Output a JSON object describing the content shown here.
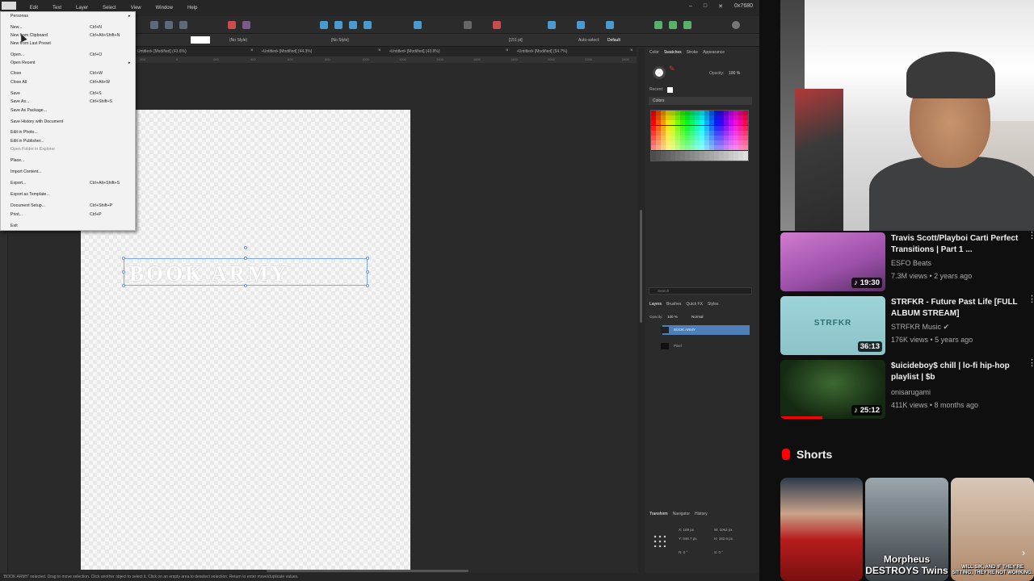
{
  "menubar": {
    "items": [
      "File",
      "Edit",
      "Text",
      "Layer",
      "Select",
      "View",
      "Window",
      "Help"
    ],
    "clock": "0x7680",
    "window_controls": [
      "–",
      "□",
      "✕"
    ]
  },
  "context_bar": {
    "style_left": "(No Style)",
    "style_right": "[No Style]",
    "font_size": "[151 pt]",
    "auto_select_label": "Auto-select:",
    "auto_select_value": "Default"
  },
  "doc_tabs": [
    {
      "label": "Untitled• [Modified] (43.6%)"
    },
    {
      "label": "•Untitled• [Modified] (44.3%)"
    },
    {
      "label": "•Untitled• [Modified] (43.8%)"
    },
    {
      "label": "•Untitled• [Modified] (54.7%)"
    }
  ],
  "file_menu": {
    "items": [
      {
        "label": "Personas",
        "shortcut": "",
        "submenu": true,
        "disabled": false
      },
      {
        "label": "New...",
        "shortcut": "Ctrl+N",
        "submenu": false,
        "disabled": false
      },
      {
        "label": "New from Clipboard",
        "shortcut": "Ctrl+Alt+Shift+N",
        "submenu": false,
        "disabled": false
      },
      {
        "label": "New from Last Preset",
        "shortcut": "",
        "submenu": false,
        "disabled": false
      },
      {
        "label": "Open...",
        "shortcut": "Ctrl+O",
        "submenu": false,
        "disabled": false
      },
      {
        "label": "Open Recent",
        "shortcut": "",
        "submenu": true,
        "disabled": false
      },
      {
        "label": "Close",
        "shortcut": "Ctrl+W",
        "submenu": false,
        "disabled": false
      },
      {
        "label": "Close All",
        "shortcut": "Ctrl+Alt+W",
        "submenu": false,
        "disabled": false
      },
      {
        "label": "Save",
        "shortcut": "Ctrl+S",
        "submenu": false,
        "disabled": false
      },
      {
        "label": "Save As...",
        "shortcut": "Ctrl+Shift+S",
        "submenu": false,
        "disabled": false
      },
      {
        "label": "Save As Package...",
        "shortcut": "",
        "submenu": false,
        "disabled": false
      },
      {
        "label": "Save History with Document",
        "shortcut": "",
        "submenu": false,
        "disabled": false
      },
      {
        "label": "Edit in Photo...",
        "shortcut": "",
        "submenu": false,
        "disabled": false
      },
      {
        "label": "Edit in Publisher...",
        "shortcut": "",
        "submenu": false,
        "disabled": false
      },
      {
        "label": "Open Folder in Explorer",
        "shortcut": "",
        "submenu": false,
        "disabled": true
      },
      {
        "label": "Place...",
        "shortcut": "",
        "submenu": false,
        "disabled": false
      },
      {
        "label": "Import Content...",
        "shortcut": "",
        "submenu": false,
        "disabled": false
      },
      {
        "label": "Export...",
        "shortcut": "Ctrl+Alt+Shift+S",
        "submenu": false,
        "disabled": false
      },
      {
        "label": "Export as Template...",
        "shortcut": "",
        "submenu": false,
        "disabled": false
      },
      {
        "label": "Document Setup...",
        "shortcut": "Ctrl+Shift+P",
        "submenu": false,
        "disabled": false
      },
      {
        "label": "Print...",
        "shortcut": "Ctrl+P",
        "submenu": false,
        "disabled": false
      },
      {
        "label": "Exit",
        "shortcut": "",
        "submenu": false,
        "disabled": false
      }
    ]
  },
  "canvas": {
    "selected_text": "BOOK ARMY"
  },
  "right_panel": {
    "top_tabs": [
      "Color",
      "Swatches",
      "Stroke",
      "Appearance"
    ],
    "opacity_label": "Opacity:",
    "opacity_value": "100 %",
    "recent_label": "Recent:",
    "palette_name": "Colors",
    "search_placeholder": "Search",
    "layer_tabs": [
      "Layers",
      "Brushes",
      "Quick FX",
      "Styles"
    ],
    "layer_opacity_label": "Opacity:",
    "layer_opacity_value": "100 %",
    "blend_mode": "Normal",
    "layers": [
      {
        "name": "BOOK ARMY",
        "selected": true
      },
      {
        "name": "Pixel",
        "selected": false
      }
    ],
    "bottom_tabs": [
      "Transform",
      "Navigator",
      "History"
    ],
    "transform": {
      "x": "189 px",
      "y": "846.7 px",
      "w": "1062 px",
      "h": "152.6 px",
      "r": "0 °",
      "s": "0 °"
    }
  },
  "status_bar": {
    "text": "'BOOK ARMY' selected. Drag to move selection. Click another object to select it. Click on an empty area to deselect selection. Return to enter move/duplicate values."
  },
  "youtube": {
    "videos": [
      {
        "title": "Travis Scott/Playboi Carti Perfect Transitions | Part 1 ...",
        "channel": "ESFO Beats",
        "meta": "7.3M views • 2 years ago",
        "duration": "19:30",
        "verified": false,
        "thumb_colors": [
          "#9b4fa8",
          "#d07bd0"
        ]
      },
      {
        "title": "STRFKR - Future Past Life [FULL ALBUM STREAM]",
        "channel": "STRFKR Music",
        "meta": "176K views • 5 years ago",
        "duration": "36:13",
        "verified": true,
        "thumb_text": "STRFKR",
        "thumb_colors": [
          "#9dd4d9",
          "#8cc3c8"
        ]
      },
      {
        "title": "$uicideboy$ chill | lo-fi hip-hop playlist | $b",
        "channel": "onisarugami",
        "meta": "411K views • 8 months ago",
        "duration": "25:12",
        "verified": false,
        "thumb_colors": [
          "#152a12",
          "#3e6a32"
        ]
      }
    ],
    "shorts_title": "Shorts",
    "shorts": [
      {
        "caption": "",
        "colors": [
          "#2b3a4a",
          "#b71c1c"
        ]
      },
      {
        "caption": "Morpheus DESTROYS Twins",
        "colors": [
          "#9aa6ad",
          "#3b4044"
        ]
      },
      {
        "caption": "WILL SIK, AND IF THEY'RE SITTING, THEY'RE NOT WORKING.",
        "colors": [
          "#d9c7b8",
          "#b08a6b"
        ]
      }
    ]
  },
  "colors": {
    "selection": "#7aa9e8",
    "layer_selected": "#4e7fb8",
    "youtube_red": "#ff0000"
  }
}
